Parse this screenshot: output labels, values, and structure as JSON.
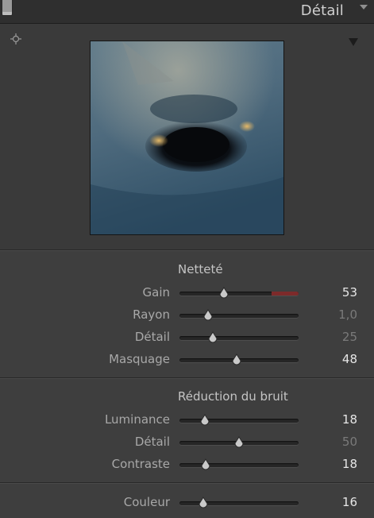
{
  "header": {
    "title": "Détail"
  },
  "sharpening": {
    "title": "Netteté",
    "rows": [
      {
        "label": "Gain",
        "value": "53",
        "fraction": 0.37
      },
      {
        "label": "Rayon",
        "value": "1,0",
        "fraction": 0.24
      },
      {
        "label": "Détail",
        "value": "25",
        "fraction": 0.28
      },
      {
        "label": "Masquage",
        "value": "48",
        "fraction": 0.48
      }
    ]
  },
  "noise_reduction": {
    "title": "Réduction du bruit",
    "rows": [
      {
        "label": "Luminance",
        "value": "18",
        "fraction": 0.21
      },
      {
        "label": "Détail",
        "value": "50",
        "fraction": 0.5
      },
      {
        "label": "Contraste",
        "value": "18",
        "fraction": 0.22
      },
      {
        "label": "Couleur",
        "value": "16",
        "fraction": 0.2
      }
    ]
  },
  "colors": {
    "header_bg": "#2f2f2f",
    "panel_bg": "#3e3e3e",
    "gain_warning": "#7c2a2a"
  }
}
